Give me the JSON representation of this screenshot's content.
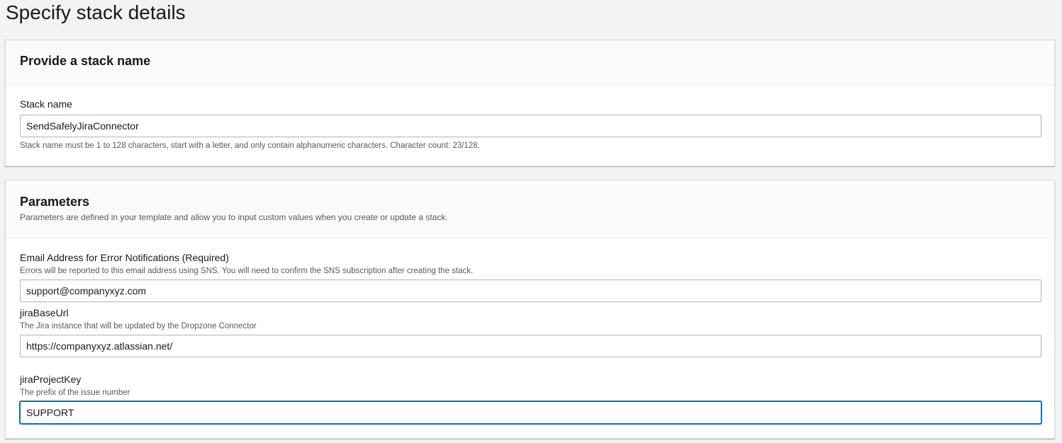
{
  "page": {
    "title": "Specify stack details"
  },
  "stack_name_panel": {
    "title": "Provide a stack name",
    "field": {
      "label": "Stack name",
      "value": "SendSafelyJiraConnector",
      "hint": "Stack name must be 1 to 128 characters, start with a letter, and only contain alphanumeric characters. Character count: 23/128."
    }
  },
  "parameters_panel": {
    "title": "Parameters",
    "description": "Parameters are defined in your template and allow you to input custom values when you create or update a stack.",
    "fields": [
      {
        "label": "Email Address for Error Notifications (Required)",
        "hint": "Errors will be reported to this email address using SNS. You will need to confirm the SNS subscription after creating the stack.",
        "value": "support@companyxyz.com"
      },
      {
        "label": "jiraBaseUrl",
        "hint": "The Jira instance that will be updated by the Dropzone Connector",
        "value": "https://companyxyz.atlassian.net/"
      },
      {
        "label": "jiraProjectKey",
        "hint": "The prefix of the issue number",
        "value": "SUPPORT"
      }
    ]
  },
  "colors": {
    "focus_border": "#0073bb",
    "input_border": "#aab7b8",
    "background": "#f2f3f3"
  }
}
